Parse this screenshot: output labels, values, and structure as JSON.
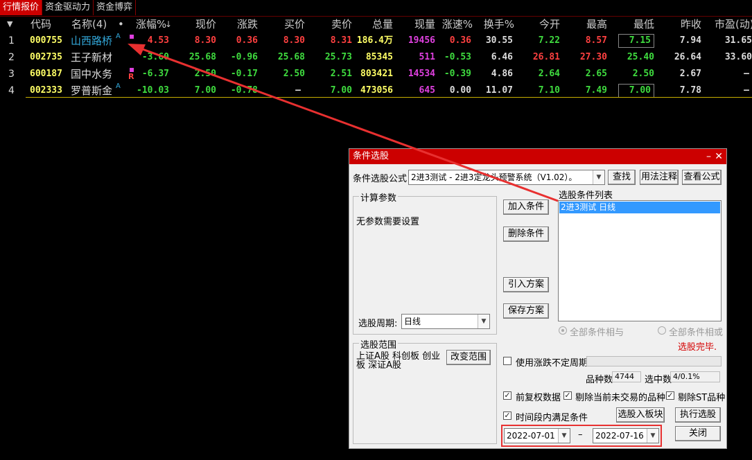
{
  "tabs": [
    {
      "label": "行情报价"
    },
    {
      "label": "资金驱动力"
    },
    {
      "label": "资金博弈"
    }
  ],
  "table": {
    "headers": {
      "code": "代码",
      "name": "名称(4)",
      "dot": "•",
      "chg_pct": "涨幅%",
      "price": "现价",
      "chg": "涨跌",
      "bid": "买价",
      "ask": "卖价",
      "volume": "总量",
      "cur_vol": "现量",
      "speed": "涨速%",
      "turnover": "换手%",
      "open": "今开",
      "high": "最高",
      "low": "最低",
      "prev_close": "昨收",
      "pe": "市盈(动)"
    },
    "sort_arrow": "↓",
    "rows": [
      {
        "idx": "1",
        "code": "000755",
        "name": "山西路桥",
        "badge": "A",
        "mark": "",
        "chg_pct": "4.53",
        "price": "8.30",
        "chg": "0.36",
        "bid": "8.30",
        "ask": "8.31",
        "volume": "186.4万",
        "cur_vol": "19456",
        "speed": "0.36",
        "turnover": "30.55",
        "open": "7.22",
        "high": "8.57",
        "low": "7.15",
        "prev_close": "7.94",
        "pe": "31.65"
      },
      {
        "idx": "2",
        "code": "002735",
        "name": "王子新材",
        "badge": "",
        "mark": "",
        "chg_pct": "-3.60",
        "price": "25.68",
        "chg": "-0.96",
        "bid": "25.68",
        "ask": "25.73",
        "volume": "85345",
        "cur_vol": "511",
        "speed": "-0.53",
        "turnover": "6.46",
        "open": "26.81",
        "high": "27.30",
        "low": "25.40",
        "prev_close": "26.64",
        "pe": "33.60"
      },
      {
        "idx": "3",
        "code": "600187",
        "name": "国中水务",
        "badge": "",
        "mark": "R",
        "chg_pct": "-6.37",
        "price": "2.50",
        "chg": "-0.17",
        "bid": "2.50",
        "ask": "2.51",
        "volume": "803421",
        "cur_vol": "14534",
        "speed": "-0.39",
        "turnover": "4.86",
        "open": "2.64",
        "high": "2.65",
        "low": "2.50",
        "prev_close": "2.67",
        "pe": "–"
      },
      {
        "idx": "4",
        "code": "002333",
        "name": "罗普斯金",
        "badge": "A",
        "mark": "",
        "chg_pct": "-10.03",
        "price": "7.00",
        "chg": "-0.78",
        "bid": "–",
        "ask": "7.00",
        "volume": "473056",
        "cur_vol": "645",
        "speed": "0.00",
        "turnover": "11.07",
        "open": "7.10",
        "high": "7.49",
        "low": "7.00",
        "prev_close": "7.78",
        "pe": "–"
      }
    ]
  },
  "dialog": {
    "title": "条件选股",
    "formula_label": "条件选股公式",
    "formula_value": "2进3测试      - 2进3定龙头预警系统（V1.02）。",
    "find_button": "查找",
    "usage_button": "用法注释",
    "view_button": "查看公式",
    "params_group": "计算参数",
    "params_text": "无参数需要设置",
    "period_label": "选股周期:",
    "period_value": "日线",
    "add_button": "加入条件",
    "delete_button": "删除条件",
    "import_button": "引入方案",
    "save_button": "保存方案",
    "conditions_label": "选股条件列表",
    "conditions": [
      "2进3测试   日线"
    ],
    "radio_and": "全部条件相与",
    "radio_or": "全部条件相或",
    "status": "选股完毕.",
    "range_group": "选股范围",
    "range_text": "上证A股 科创板 创业板 深证A股",
    "change_range_button": "改变范围",
    "uncertain_period_label": "使用涨跌不定周期",
    "count_label": "品种数",
    "count_value": "4744",
    "selected_label": "选中数",
    "selected_value": "4/0.1%",
    "adjusted_label": "前复权数据",
    "exclude_untraded_label": "剔除当前未交易的品种",
    "exclude_st_label": "剔除ST品种",
    "period_satisfy_label": "时间段内满足条件",
    "to_board_button": "选股入板块",
    "run_button": "执行选股",
    "date_from": "2022-07-01",
    "date_sep": "–",
    "date_to": "2022-07-16",
    "close_button": "关闭",
    "checked_mark": "✓"
  },
  "colors": {
    "accent": "#cc0000",
    "up": "#ff4040",
    "down": "#3fdc3f",
    "code": "#ffff66",
    "volume_cur": "#e040e0",
    "selected": "#3399ff",
    "annotation": "#e83030"
  }
}
